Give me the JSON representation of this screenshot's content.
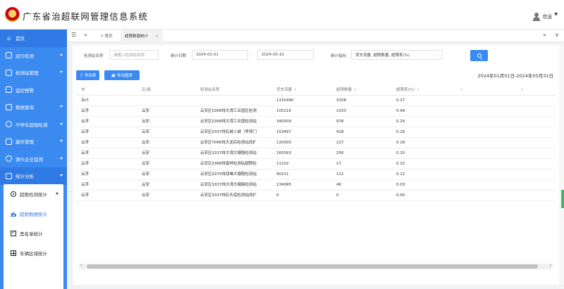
{
  "header": {
    "title": "广东省治超联网管理信息系统",
    "user": "信息",
    "user_caret": "▼"
  },
  "sidebar": {
    "items": [
      {
        "label": "首页",
        "icon": "home-icon",
        "glyph": "⌂"
      },
      {
        "label": "运行检测",
        "icon": "monitor-icon"
      },
      {
        "label": "检测站管理",
        "icon": "station-icon"
      },
      {
        "label": "监控预警",
        "icon": "alert-icon"
      },
      {
        "label": "数据查询",
        "icon": "query-icon"
      },
      {
        "label": "不停车超限检测",
        "icon": "truck-icon"
      },
      {
        "label": "案件管理",
        "icon": "case-icon"
      },
      {
        "label": "源头企业监测",
        "icon": "factory-icon"
      },
      {
        "label": "统计分析",
        "icon": "chart-icon"
      }
    ],
    "submenu": [
      {
        "label": "超限检测统计",
        "icon": "radio-icon"
      },
      {
        "label": "超限数据统计",
        "icon": "bar-chart-icon"
      },
      {
        "label": "黑名单统计",
        "icon": "checkbox-icon"
      },
      {
        "label": "车辆区域统计",
        "icon": "grid-icon"
      }
    ]
  },
  "tabbar": {
    "menu_glyph": "☰",
    "collapse_glyph": "«",
    "home_tab": "首页",
    "home_glyph": "⌂",
    "active_tab": "超限数据统计",
    "close_glyph": "×",
    "expand_glyph": "»",
    "more_glyph": "∨"
  },
  "filters": {
    "station_label": "检测站名称",
    "station_placeholder": "请输入检测站名称",
    "date_label": "统计日期",
    "start_date": "2024-01-01",
    "date_sep": "-",
    "end_date": "2024-05-31",
    "stat_label": "统计指标",
    "stat_value": "货车流量, 超限数量, 超限率(%)",
    "select_caret": "⌄"
  },
  "actions": {
    "export_label": "导出表",
    "export_glyph": "↧",
    "chart_label": "导出图表",
    "chart_glyph": "▣",
    "date_range": "2024年01月01日-2024年05月31日"
  },
  "table": {
    "headers": [
      "市",
      "区/县",
      "检测站名称",
      "货车流量",
      "超限数量",
      "超限率(%)",
      "",
      ""
    ],
    "sort_glyph": "⇕",
    "rows": [
      [
        "合计",
        "",
        "",
        "1132440",
        "3108",
        "0.27"
      ],
      [
        "云浮",
        "云安",
        "云安区S368线大湾工业园区检测",
        "105216",
        "1033",
        "0.99"
      ],
      [
        "云浮",
        "云安",
        "云安区S368线大湾工业园检测站",
        "340009",
        "978",
        "0.29"
      ],
      [
        "云浮",
        "云安",
        "云安区S337线石城入城（李洞门",
        "153497",
        "428",
        "0.28"
      ],
      [
        "云浮",
        "云安",
        "云安区Y066线大龙后检测站改扩",
        "120000",
        "217",
        "0.18"
      ],
      [
        "云浮",
        "云安",
        "云安区S337线大湾大塘路检测站",
        "165583",
        "256",
        "0.15"
      ],
      [
        "云浮",
        "云安",
        "云安区S368线富林检测站超限检",
        "11102",
        "17",
        "0.15"
      ],
      [
        "云浮",
        "云安",
        "云安区S370线双峰大塘路检测站",
        "90211",
        "111",
        "0.12"
      ],
      [
        "云浮",
        "云安",
        "云安区S337线大湾大塘路检测站",
        "134095",
        "46",
        "0.03"
      ],
      [
        "云浮",
        "云安",
        "云安区S337线石头底检测站改扩",
        "0",
        "0",
        "0.00"
      ]
    ]
  },
  "scrollbar": {
    "left_glyph": "‹",
    "right_glyph": "›"
  }
}
